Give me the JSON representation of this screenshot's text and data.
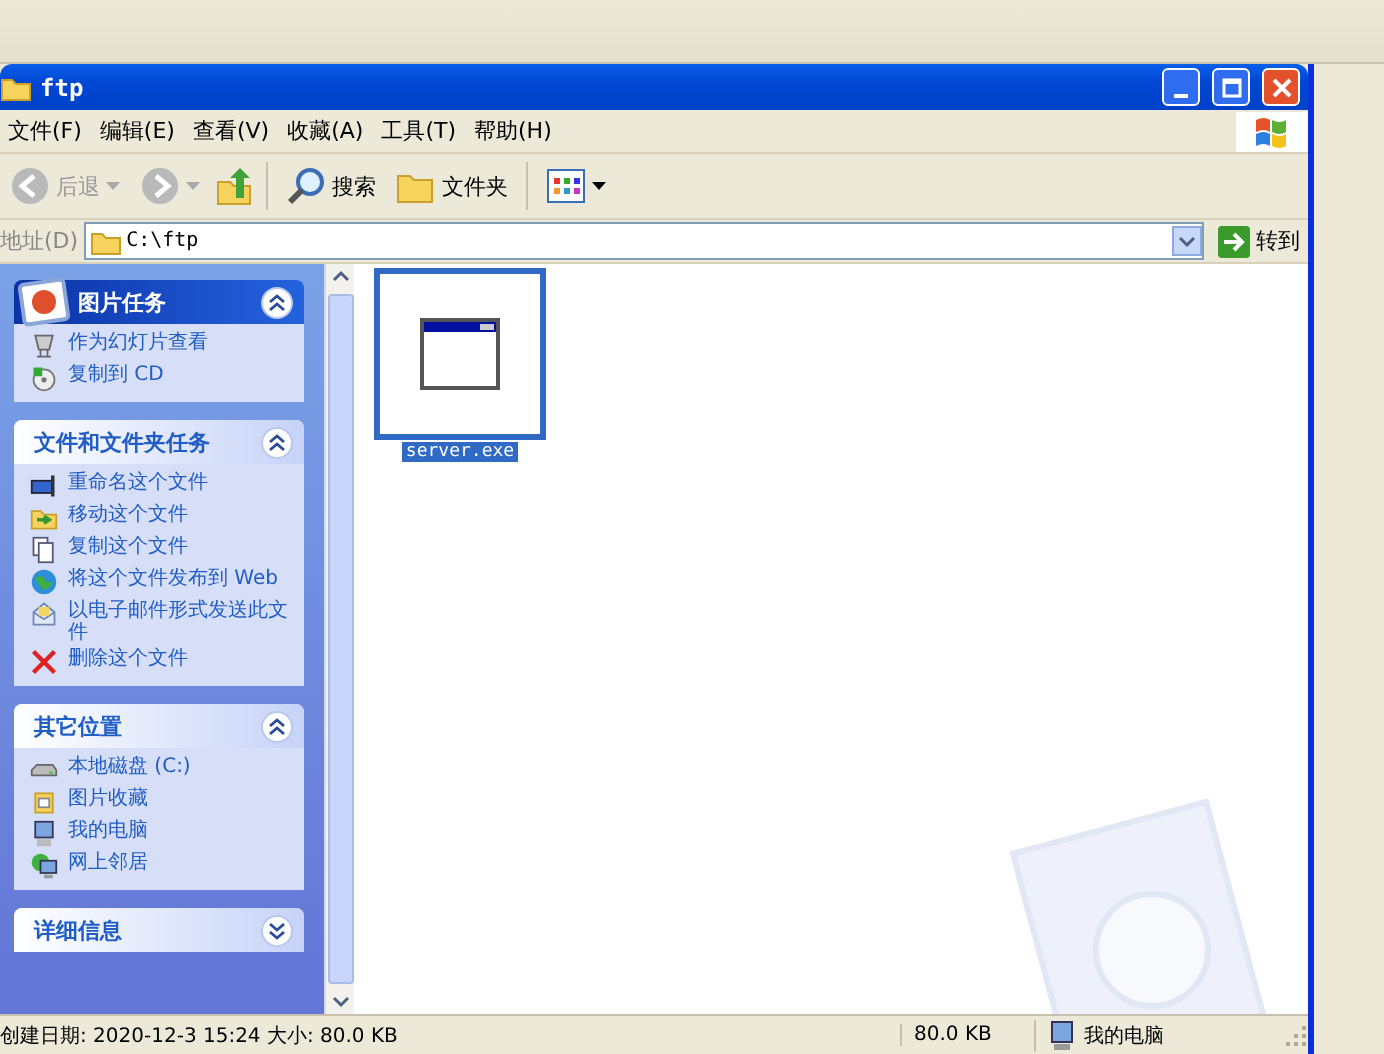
{
  "window": {
    "title": "ftp"
  },
  "menu": [
    "文件(F)",
    "编辑(E)",
    "查看(V)",
    "收藏(A)",
    "工具(T)",
    "帮助(H)"
  ],
  "toolbar": {
    "back": "后退",
    "search": "搜索",
    "folders": "文件夹"
  },
  "address": {
    "label": "地址(D)",
    "value": "C:\\ftp",
    "go": "转到"
  },
  "task_panes": [
    {
      "title": "图片任务",
      "kind": "special",
      "expanded": true,
      "items": [
        "作为幻灯片查看",
        "复制到 CD"
      ]
    },
    {
      "title": "文件和文件夹任务",
      "kind": "normal",
      "expanded": true,
      "items": [
        "重命名这个文件",
        "移动这个文件",
        "复制这个文件",
        "将这个文件发布到 Web",
        "以电子邮件形式发送此文件",
        "删除这个文件"
      ]
    },
    {
      "title": "其它位置",
      "kind": "normal",
      "expanded": true,
      "items": [
        "本地磁盘 (C:)",
        "图片收藏",
        "我的电脑",
        "网上邻居"
      ]
    },
    {
      "title": "详细信息",
      "kind": "normal",
      "expanded": false
    }
  ],
  "files": [
    {
      "name": "server.exe",
      "selected": true
    }
  ],
  "status_bar": {
    "details": "创建日期: 2020-12-3 15:24 大小: 80.0 KB",
    "size": "80.0 KB",
    "zone": "我的电脑"
  }
}
